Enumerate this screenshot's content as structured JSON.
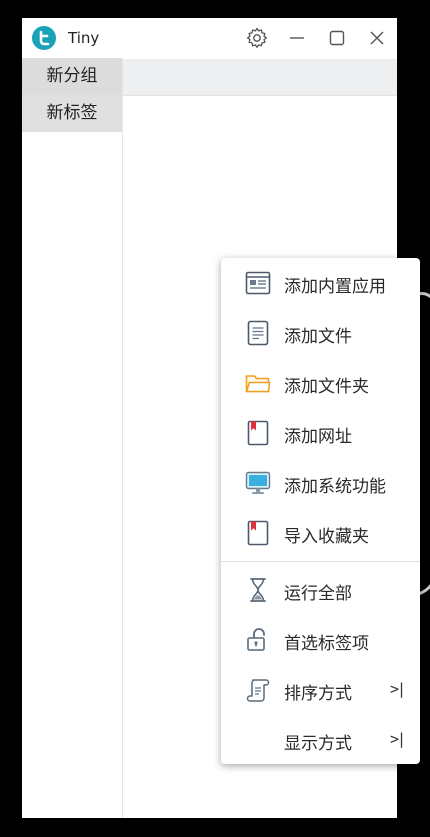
{
  "app": {
    "title": "Tiny"
  },
  "groups": [
    {
      "label": "新分组"
    },
    {
      "label": "新标签"
    }
  ],
  "menu": {
    "items": [
      {
        "label": "添加内置应用",
        "icon": "builtin-app-icon"
      },
      {
        "label": "添加文件",
        "icon": "file-icon"
      },
      {
        "label": "添加文件夹",
        "icon": "folder-icon"
      },
      {
        "label": "添加网址",
        "icon": "bookmark-icon"
      },
      {
        "label": "添加系统功能",
        "icon": "monitor-icon"
      },
      {
        "label": "导入收藏夹",
        "icon": "bookmark-import-icon"
      },
      {
        "label": "运行全部",
        "icon": "hourglass-icon"
      },
      {
        "label": "首选标签项",
        "icon": "unlock-icon"
      },
      {
        "label": "排序方式",
        "icon": "scroll-icon",
        "submenu": true
      },
      {
        "label": "显示方式",
        "icon": "",
        "submenu": true
      }
    ],
    "submenu_arrow": ">|"
  },
  "colors": {
    "accent": "#1aa3b8",
    "folder": "#f0a020",
    "bookmark_red": "#e03040",
    "monitor": "#3ab0e0"
  }
}
